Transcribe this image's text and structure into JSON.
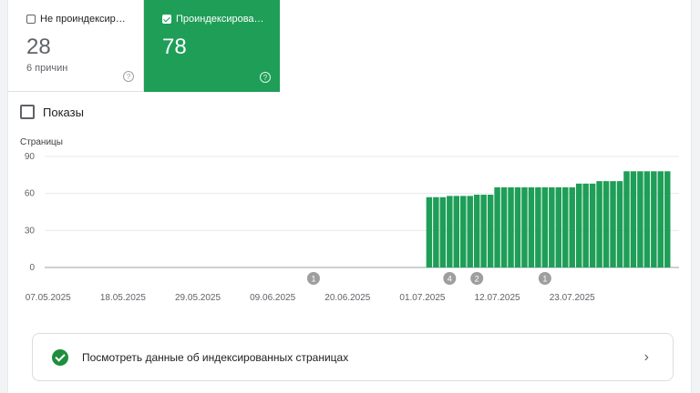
{
  "tiles": {
    "not_indexed": {
      "label": "Не проиндексир…",
      "count": "28",
      "sub": "6 причин",
      "checked": false
    },
    "indexed": {
      "label": "Проиндексирова…",
      "count": "78",
      "checked": true
    }
  },
  "toggle": {
    "label": "Показы",
    "checked": false
  },
  "colors": {
    "indexed": "#1e9e57",
    "annotation": "#9e9e9e"
  },
  "chart_data": {
    "type": "bar",
    "ylabel": "Страницы",
    "ylim": [
      0,
      90
    ],
    "yticks": [
      "90",
      "60",
      "30",
      "0"
    ],
    "xticks": [
      "07.05.2025",
      "18.05.2025",
      "29.05.2025",
      "09.06.2025",
      "20.06.2025",
      "01.07.2025",
      "12.07.2025",
      "23.07.2025"
    ],
    "start_date": "2025-05-07",
    "series": [
      {
        "values": [
          0,
          0,
          0,
          0,
          0,
          0,
          0,
          0,
          0,
          0,
          0,
          0,
          0,
          0,
          0,
          0,
          0,
          0,
          0,
          0,
          0,
          0,
          0,
          0,
          0,
          0,
          0,
          0,
          0,
          0,
          0,
          0,
          0,
          0,
          0,
          0,
          0,
          0,
          0,
          0,
          0,
          0,
          0,
          0,
          0,
          0,
          0,
          0,
          0,
          0,
          0,
          0,
          0,
          0,
          0,
          0,
          57,
          57,
          57,
          58,
          58,
          58,
          58,
          59,
          59,
          59,
          65,
          65,
          65,
          65,
          65,
          65,
          65,
          65,
          65,
          65,
          65,
          65,
          68,
          68,
          68,
          70,
          70,
          70,
          70,
          78,
          78,
          78,
          78,
          78,
          78,
          78
        ]
      }
    ],
    "annotations": [
      {
        "x": "15.06.2025",
        "label": "1"
      },
      {
        "x": "05.07.2025",
        "label": "4"
      },
      {
        "x": "09.07.2025",
        "label": "2"
      },
      {
        "x": "19.07.2025",
        "label": "1"
      }
    ]
  },
  "footer": {
    "text": "Посмотреть данные об индексированных страницах",
    "chevron": "chevron-right-icon"
  }
}
